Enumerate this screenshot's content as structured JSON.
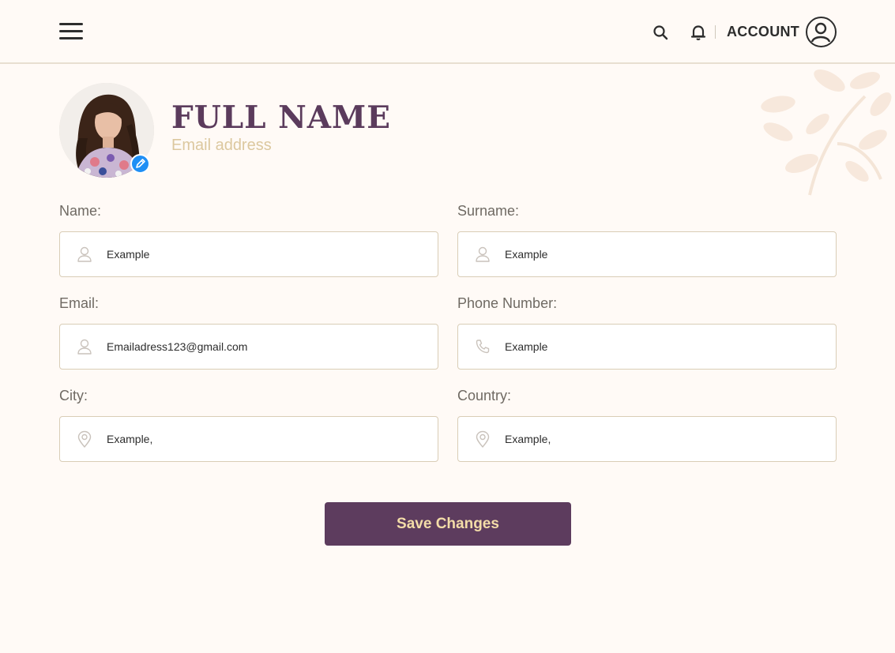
{
  "header": {
    "menu_icon": "hamburger-menu-icon",
    "search_icon": "search-icon",
    "bell_icon": "bell-icon",
    "account_label": "ACCOUNT",
    "account_icon": "user-circle-icon"
  },
  "profile": {
    "full_name": "FULL NAME",
    "email": "Email address",
    "photo_icon": "profile-photo",
    "edit_icon": "pencil-icon"
  },
  "form": {
    "name": {
      "label": "Name:",
      "value": "Example",
      "icon": "user-icon"
    },
    "surname": {
      "label": "Surname:",
      "value": "Example",
      "icon": "user-icon"
    },
    "email": {
      "label": "Email:",
      "value": "Emailadress123@gmail.com",
      "icon": "user-icon"
    },
    "phone": {
      "label": "Phone Number:",
      "value": "Example",
      "icon": "phone-icon"
    },
    "city": {
      "label": "City:",
      "value": "Example,",
      "icon": "location-pin-icon"
    },
    "country": {
      "label": "Country:",
      "value": "Example,",
      "icon": "location-pin-icon"
    }
  },
  "actions": {
    "save_label": "Save Changes"
  },
  "colors": {
    "background": "#fffaf6",
    "brand_purple": "#5d3c5e",
    "button_text": "#f3dca8",
    "muted_gold": "#dcc89f",
    "edit_blue": "#1f8ff5"
  }
}
